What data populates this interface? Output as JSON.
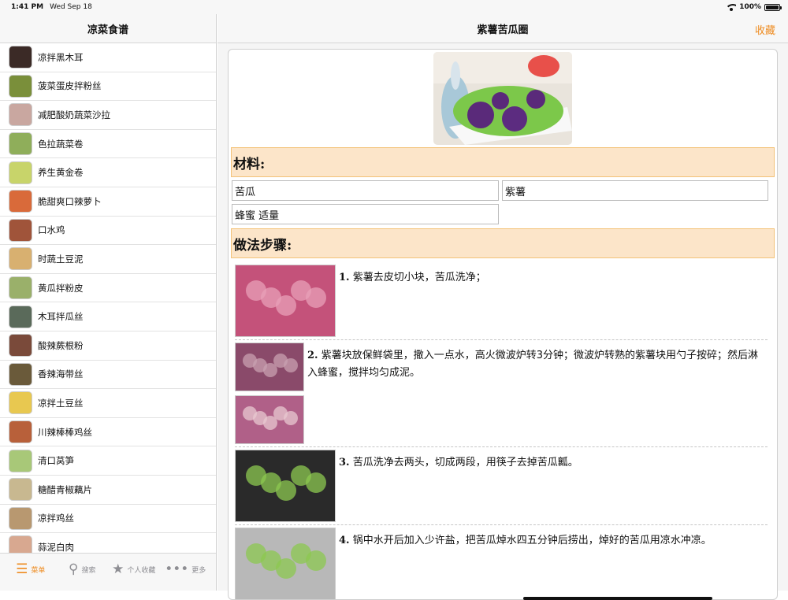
{
  "status": {
    "time": "1:41 PM",
    "date": "Wed Sep 18",
    "battery": "100%"
  },
  "sidebar": {
    "title": "凉菜食谱",
    "items": [
      {
        "label": "凉拌黑木耳",
        "color": "#3b2a26"
      },
      {
        "label": "菠菜蛋皮拌粉丝",
        "color": "#7a8f3a"
      },
      {
        "label": "减肥酸奶蔬菜沙拉",
        "color": "#c9a7a0"
      },
      {
        "label": "色拉蔬菜卷",
        "color": "#8fae5a"
      },
      {
        "label": "养生黄金卷",
        "color": "#c8d46a"
      },
      {
        "label": "脆甜爽口辣萝卜",
        "color": "#d96a3a"
      },
      {
        "label": "口水鸡",
        "color": "#a0543a"
      },
      {
        "label": "时蔬土豆泥",
        "color": "#d8b070"
      },
      {
        "label": "黄瓜拌粉皮",
        "color": "#9ab06a"
      },
      {
        "label": "木耳拌瓜丝",
        "color": "#5a6a5a"
      },
      {
        "label": "酸辣蕨根粉",
        "color": "#7a4a3a"
      },
      {
        "label": "香辣海带丝",
        "color": "#6a5a3a"
      },
      {
        "label": "凉拌土豆丝",
        "color": "#e8c850"
      },
      {
        "label": "川辣棒棒鸡丝",
        "color": "#b8603a"
      },
      {
        "label": "清口莴笋",
        "color": "#a8c878"
      },
      {
        "label": "糖醋青椒藕片",
        "color": "#c8b890"
      },
      {
        "label": "凉拌鸡丝",
        "color": "#b89870"
      },
      {
        "label": "蒜泥白肉",
        "color": "#d8a890"
      }
    ]
  },
  "tabs": [
    {
      "label": "菜单",
      "icon": "menu-icon",
      "glyph": "☰",
      "active": true
    },
    {
      "label": "搜索",
      "icon": "search-icon",
      "glyph": "⚲",
      "active": false
    },
    {
      "label": "个人收藏",
      "icon": "star-icon",
      "glyph": "★",
      "active": false
    },
    {
      "label": "更多",
      "icon": "more-icon",
      "glyph": "•••",
      "active": false
    }
  ],
  "recipe": {
    "title": "紫薯苦瓜圈",
    "favorite_label": "收藏",
    "materials_heading": "材料:",
    "ingredients": [
      "苦瓜",
      "紫薯",
      "蜂蜜 适量"
    ],
    "steps_heading": "做法步骤:",
    "steps": [
      {
        "num": "1.",
        "text": "紫薯去皮切小块，苦瓜洗净；"
      },
      {
        "num": "2.",
        "text": "紫薯块放保鲜袋里，撒入一点水，高火微波炉转3分钟；微波炉转熟的紫薯块用勺子按碎；然后淋入蜂蜜，搅拌均匀成泥。"
      },
      {
        "num": "3.",
        "text": "苦瓜洗净去两头，切成两段，用筷子去掉苦瓜瓤。"
      },
      {
        "num": "4.",
        "text": "锅中水开后加入少许盐，把苦瓜焯水四五分钟后捞出，焯好的苦瓜用凉水冲凉。"
      }
    ]
  },
  "colors": {
    "accent": "#ee8b1f",
    "section_bg": "#fce5c9",
    "section_border": "#f3c278"
  }
}
